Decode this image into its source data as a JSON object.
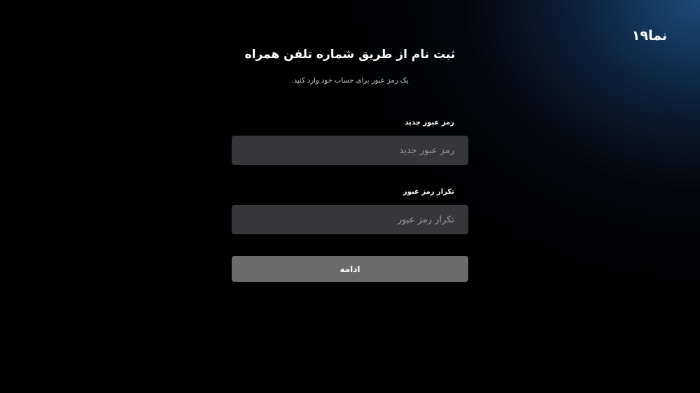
{
  "brand": {
    "logo_text": "نما۱۹"
  },
  "form": {
    "title": "ثبت نام از طریق شماره تلفن همراه",
    "subtitle": "یک رمز عبور برای حساب خود وارد کنید.",
    "new_password": {
      "label": "رمز عبور جدید",
      "placeholder": "رمز عبور جدید",
      "value": ""
    },
    "repeat_password": {
      "label": "تکرار رمز عبور",
      "placeholder": "تکرار رمز عبور",
      "value": ""
    },
    "continue_label": "ادامه"
  },
  "colors": {
    "background": "#000000",
    "glow": "#1e4e80",
    "input_bg": "#37373b",
    "button_bg": "#6b6b6b",
    "text": "#ffffff"
  }
}
